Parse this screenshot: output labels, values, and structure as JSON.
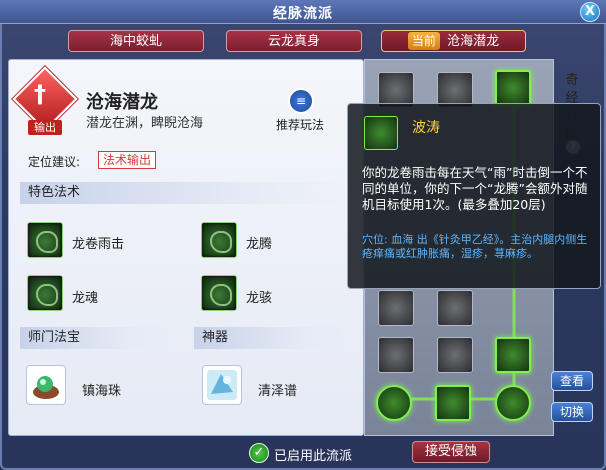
{
  "window": {
    "title": "经脉流派",
    "close_label": "X"
  },
  "tabs": [
    {
      "label": "海中蛟虬"
    },
    {
      "label": "云龙真身"
    },
    {
      "current_tag": "当前",
      "label": "沧海潜龙"
    }
  ],
  "style": {
    "emblem_label": "输出",
    "name": "沧海潜龙",
    "description": "潜龙在渊，睥睨沧海",
    "recommend_label": "推荐玩法",
    "position_label": "定位建议:",
    "position_value": "法术输出"
  },
  "sections": {
    "special": "特色法术",
    "treasure": "师门法宝",
    "artifact": "神器"
  },
  "skills": [
    {
      "label": "龙卷雨击"
    },
    {
      "label": "龙腾"
    },
    {
      "label": "龙魂"
    },
    {
      "label": "龙骇"
    }
  ],
  "treasure": {
    "label": "镇海珠"
  },
  "artifact": {
    "label": "清泽谱"
  },
  "meridian": {
    "side_title": "奇经八脉",
    "help": "?",
    "view_label": "查看",
    "switch_label": "切换"
  },
  "tooltip": {
    "name": "波涛",
    "description": "你的龙卷雨击每在天气“雨”时击倒一个不同的单位，你的下一个“龙腾”会额外对随机目标使用1次。(最多叠加20层)",
    "note": "穴位: 血海 出《针灸甲乙经》。主治内腿内侧生疮痒痛或红肿胀痛，湿疹，荨麻疹。"
  },
  "footer": {
    "enabled_text": "已启用此流派",
    "accept_label": "接受侵蚀"
  },
  "colors": {
    "accent_red": "#c21f1f",
    "gold": "#ffd43a",
    "green": "#7ff04f"
  }
}
